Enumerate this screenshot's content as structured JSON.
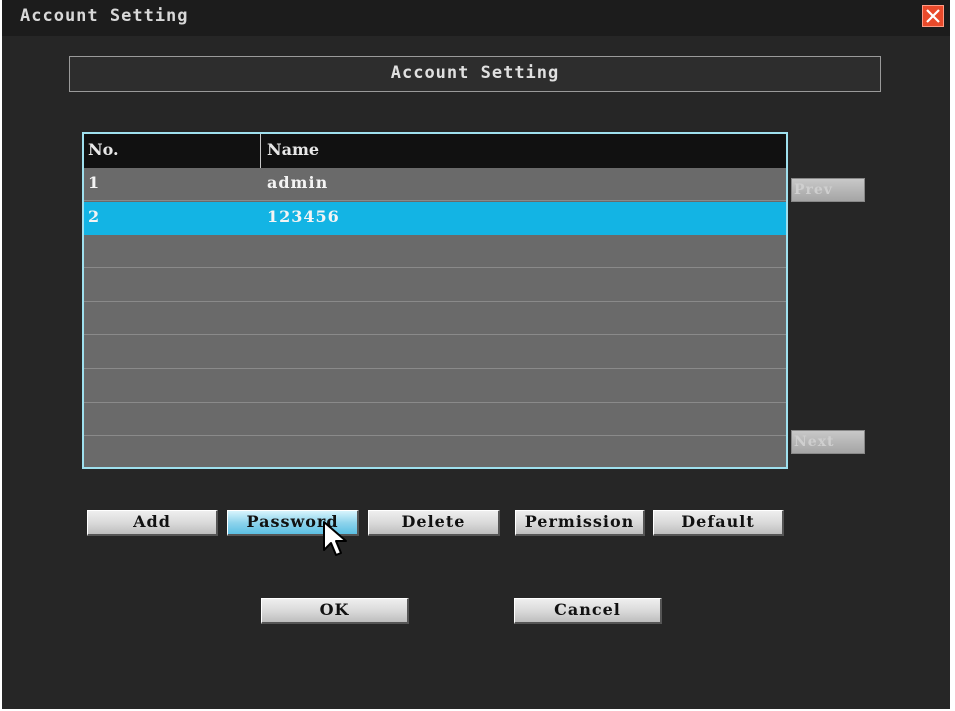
{
  "window": {
    "title": "Account Setting"
  },
  "header": {
    "title": "Account Setting"
  },
  "table": {
    "columns": [
      "No.",
      "Name"
    ],
    "rows": [
      {
        "no": "1",
        "name": "admin"
      },
      {
        "no": "2",
        "name": "123456"
      },
      {
        "no": "",
        "name": ""
      },
      {
        "no": "",
        "name": ""
      },
      {
        "no": "",
        "name": ""
      },
      {
        "no": "",
        "name": ""
      },
      {
        "no": "",
        "name": ""
      },
      {
        "no": "",
        "name": ""
      },
      {
        "no": "",
        "name": ""
      }
    ],
    "selected_row_index": 1
  },
  "pager": {
    "prev_label": "Prev",
    "next_label": "Next"
  },
  "actions": {
    "add": "Add",
    "password": "Password",
    "delete": "Delete",
    "permission": "Permission",
    "default": "Default"
  },
  "dialog": {
    "ok": "OK",
    "cancel": "Cancel"
  },
  "colors": {
    "selection": "#13b4e4",
    "table_border": "#9fe0ee",
    "close_button": "#e94a2b"
  },
  "icons": {
    "close": "close-icon",
    "cursor": "mouse-pointer-icon"
  }
}
